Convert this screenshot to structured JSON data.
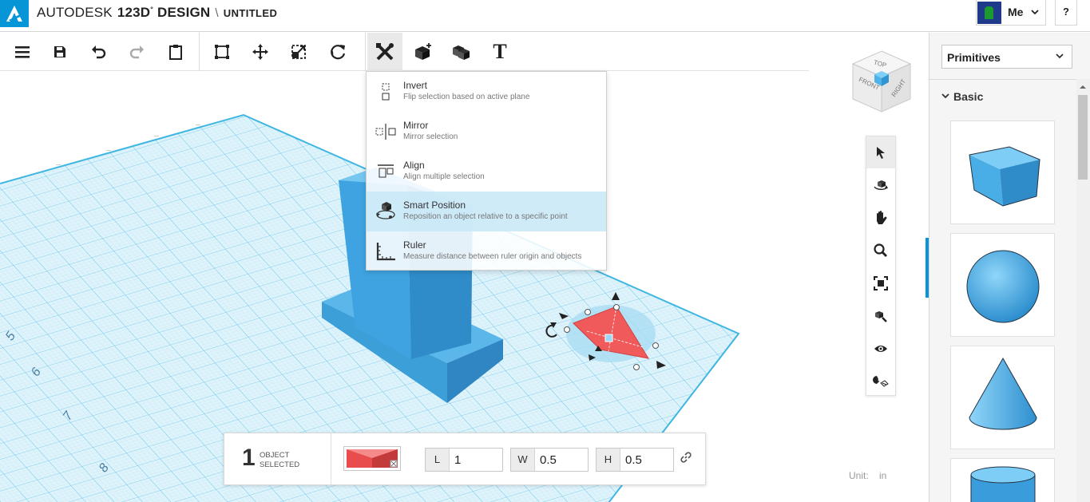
{
  "app": {
    "brand": "AUTODESK",
    "product": "123D",
    "product_mark": "°",
    "product_suffix": "DESIGN",
    "separator": "\\",
    "document": "UNTITLED"
  },
  "user": {
    "name": "Me",
    "chevron": "⌄",
    "help": "?"
  },
  "toolbar": {
    "items": [
      "menu-icon",
      "save-icon",
      "undo-icon",
      "redo-icon",
      "paste-icon",
      "smart-scale-icon",
      "move-icon",
      "scale-icon",
      "rotate-icon",
      "modify-tools-icon",
      "construct-icon",
      "combine-icon",
      "text-icon"
    ],
    "text_tool_glyph": "T"
  },
  "modify_menu": {
    "items": [
      {
        "label": "Invert",
        "description": "Flip selection based on active plane",
        "icon": "invert-icon"
      },
      {
        "label": "Mirror",
        "description": "Mirror selection",
        "icon": "mirror-icon"
      },
      {
        "label": "Align",
        "description": "Align multiple selection",
        "icon": "align-icon"
      },
      {
        "label": "Smart Position",
        "description": "Reposition an object relative to a specific point",
        "icon": "smart-position-icon",
        "highlighted": true
      },
      {
        "label": "Ruler",
        "description": "Measure distance between ruler origin and objects",
        "icon": "ruler-icon"
      }
    ]
  },
  "viewcube": {
    "top": "TOP",
    "front": "FRONT",
    "right": "RIGHT"
  },
  "navbar": {
    "items": [
      "select-icon",
      "orbit-icon",
      "pan-icon",
      "zoom-icon",
      "fit-icon",
      "zoom-selected-icon",
      "visibility-icon",
      "snap-icon"
    ]
  },
  "grid": {
    "ruler_labels": [
      "5",
      "6",
      "7",
      "8"
    ]
  },
  "right_panel": {
    "dropdown": "Primitives",
    "section": "Basic",
    "section_chevron": "⌄",
    "primitives": [
      "box",
      "sphere",
      "cone",
      "cylinder"
    ]
  },
  "selection": {
    "count": "1",
    "line1": "OBJECT",
    "line2": "SELECTED",
    "color": "#e84c4c",
    "dims": {
      "L": "1",
      "W": "0.5",
      "H": "0.5"
    },
    "dim_keys": {
      "l": "L",
      "w": "W",
      "h": "H"
    }
  },
  "unit": {
    "label": "Unit:",
    "value": "in"
  },
  "colors": {
    "accent": "#0696d7",
    "grid": "#5cc3e6",
    "object": "#4aa8dc",
    "selected": "#f05a5a"
  }
}
